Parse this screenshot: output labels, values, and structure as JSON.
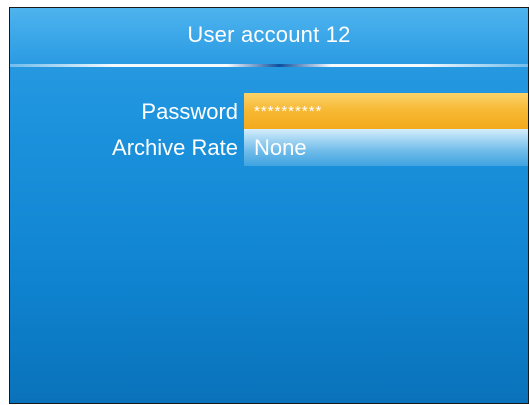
{
  "header": {
    "title": "User account 12"
  },
  "fields": [
    {
      "label": "Password",
      "value": "**********"
    },
    {
      "label": "Archive Rate",
      "value": "None"
    }
  ],
  "colors": {
    "background": "#1c92dd",
    "title_bar": "#3aa6e8",
    "selected_field": "#f7b935",
    "field": "#6fbbe9",
    "text": "#ffffff"
  }
}
